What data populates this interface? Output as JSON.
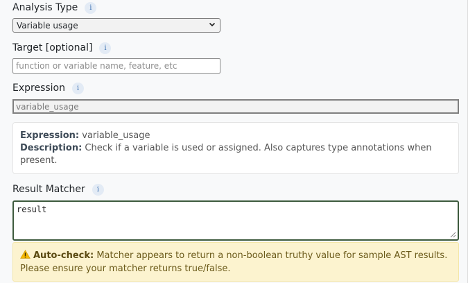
{
  "analysis_type": {
    "label": "Analysis Type",
    "info": "i",
    "selected": "Variable usage"
  },
  "target": {
    "label": "Target [optional]",
    "info": "i",
    "placeholder": "function or variable name, feature, etc",
    "value": ""
  },
  "expression": {
    "label": "Expression",
    "info": "i",
    "value": "variable_usage"
  },
  "description_card": {
    "expression_label": "Expression:",
    "expression_value": "variable_usage",
    "description_label": "Description:",
    "description_value": "Check if a variable is used or assigned. Also captures type annotations when present."
  },
  "result_matcher": {
    "label": "Result Matcher",
    "info": "i",
    "value": "result"
  },
  "warning": {
    "icon": "warning-icon",
    "title": "Auto-check:",
    "message": "Matcher appears to return a non-boolean truthy value for sample AST results. Please ensure your matcher returns true/false."
  }
}
